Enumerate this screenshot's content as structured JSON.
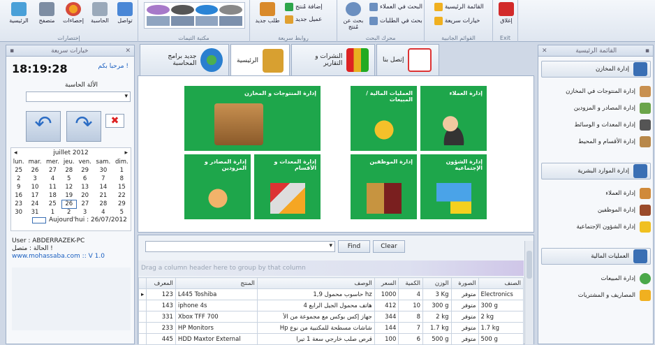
{
  "ribbon": {
    "groups": [
      {
        "label": "إختصارات",
        "buttons": [
          "تواصل",
          "الحاسبة",
          "إحصاءات",
          "متصفح",
          "الرئيسية"
        ]
      },
      {
        "label": "مكتبة التيمات"
      },
      {
        "label": "روابط سريعة",
        "small": [
          "إضافة مُنتج",
          "عميل جديد"
        ],
        "big": "طلب جديد"
      },
      {
        "label": "محرك البحث",
        "big": "بحث عن مُنتج",
        "small": [
          "البحث في العملاء",
          "بحث في الطلبات"
        ]
      },
      {
        "label": "القوائم الجانبية",
        "small": [
          "القائمة الرئيسية",
          "خيارات سريعة"
        ]
      },
      {
        "label": "Exit",
        "big": "إغلاق"
      }
    ]
  },
  "left": {
    "title": "خيارات سريعة",
    "clock": "18:19:28",
    "welcome": "مرحبا بكم !",
    "calc_label": "الألة الحاسبة",
    "cal": {
      "month": "juillet 2012",
      "days": [
        "lun.",
        "mar.",
        "mer.",
        "jeu.",
        "ven.",
        "sam.",
        "dim."
      ],
      "weeks": [
        [
          "25",
          "26",
          "27",
          "28",
          "29",
          "30",
          "1"
        ],
        [
          "2",
          "3",
          "4",
          "5",
          "6",
          "7",
          "8"
        ],
        [
          "9",
          "10",
          "11",
          "12",
          "13",
          "14",
          "15"
        ],
        [
          "16",
          "17",
          "18",
          "19",
          "20",
          "21",
          "22"
        ],
        [
          "23",
          "24",
          "25",
          "26",
          "27",
          "28",
          "29"
        ],
        [
          "30",
          "31",
          "1",
          "2",
          "3",
          "4",
          "5"
        ]
      ],
      "today": "Aujourd'hui : 26/07/2012"
    },
    "user": "User : ABDERRAZEK-PC",
    "status": "الحالة : متصل !",
    "site": "www.mohassaba.com :: V 1.0"
  },
  "tabs": [
    "جديد برامج المحاسبة",
    "الرئيسية",
    "النشرات و التقارير",
    "إتصل بنا"
  ],
  "tiles": [
    "إدارة المنتوجات و المخازن",
    "العمليات المالية / المبيعات",
    "إدارة العملاء",
    "إدارة المصادر و المزودين",
    "إدارة المعدات و الأقسام",
    "إدارة الموظفين",
    "إدارة الشؤون الإجتماعية"
  ],
  "grid": {
    "find": "Find",
    "clear": "Clear",
    "group_hint": "Drag a column header here to group by that column",
    "headers": [
      "المعرف",
      "المنتج",
      "الوصف",
      "السعر",
      "الكمية",
      "الوزن",
      "الصورة",
      "الصنف"
    ],
    "rows": [
      [
        "123",
        "L445 Toshiba",
        "حاسوب محمول 1,9 hz",
        "1000",
        "4",
        "3 Kg",
        "متوفر",
        "Electronics"
      ],
      [
        "143",
        "iphone 4s",
        "هاتف محمول الجيل الرابع 4",
        "412",
        "10",
        "300 g",
        "متوفر",
        "300 g"
      ],
      [
        "331",
        "Xbox TFF 700",
        "جهاز إكس بوكس مع مجموعة من الأ",
        "344",
        "8",
        "2 kg",
        "متوفر",
        "2 kg"
      ],
      [
        "233",
        "HP Monitors",
        "Hp شاشات مسطحة للمكتبية من نوع",
        "144",
        "7",
        "1.7 kg",
        "متوفر",
        "1.7 kg"
      ],
      [
        "445",
        "HDD Maxtor External",
        "قرص صلب خارجي سعة 1 تيرا",
        "100",
        "6",
        "500 g",
        "متوفر",
        "500 g"
      ]
    ]
  },
  "right": {
    "title": "القائمة الرئيسية",
    "sections": [
      {
        "label": "إدارة المخازن",
        "items": [
          "إدارة المنتوجات في المخازن",
          "إدارة المصادر و المزودين",
          "إدارة المعدات و الوسائط",
          "إدارة الأقسام و المحيط"
        ]
      },
      {
        "label": "إدارة الموارد البشرية",
        "items": [
          "إدارة العملاء",
          "إدارة الموظفين",
          "إدارة الشؤون الإجتماعية"
        ]
      },
      {
        "label": "العمليات المالية",
        "items": [
          "إدارة المبيعات",
          "المصاريف و المشتريات"
        ]
      }
    ]
  },
  "colors": {
    "tile": "#1ea64b",
    "accent": "#3a6fb4"
  }
}
